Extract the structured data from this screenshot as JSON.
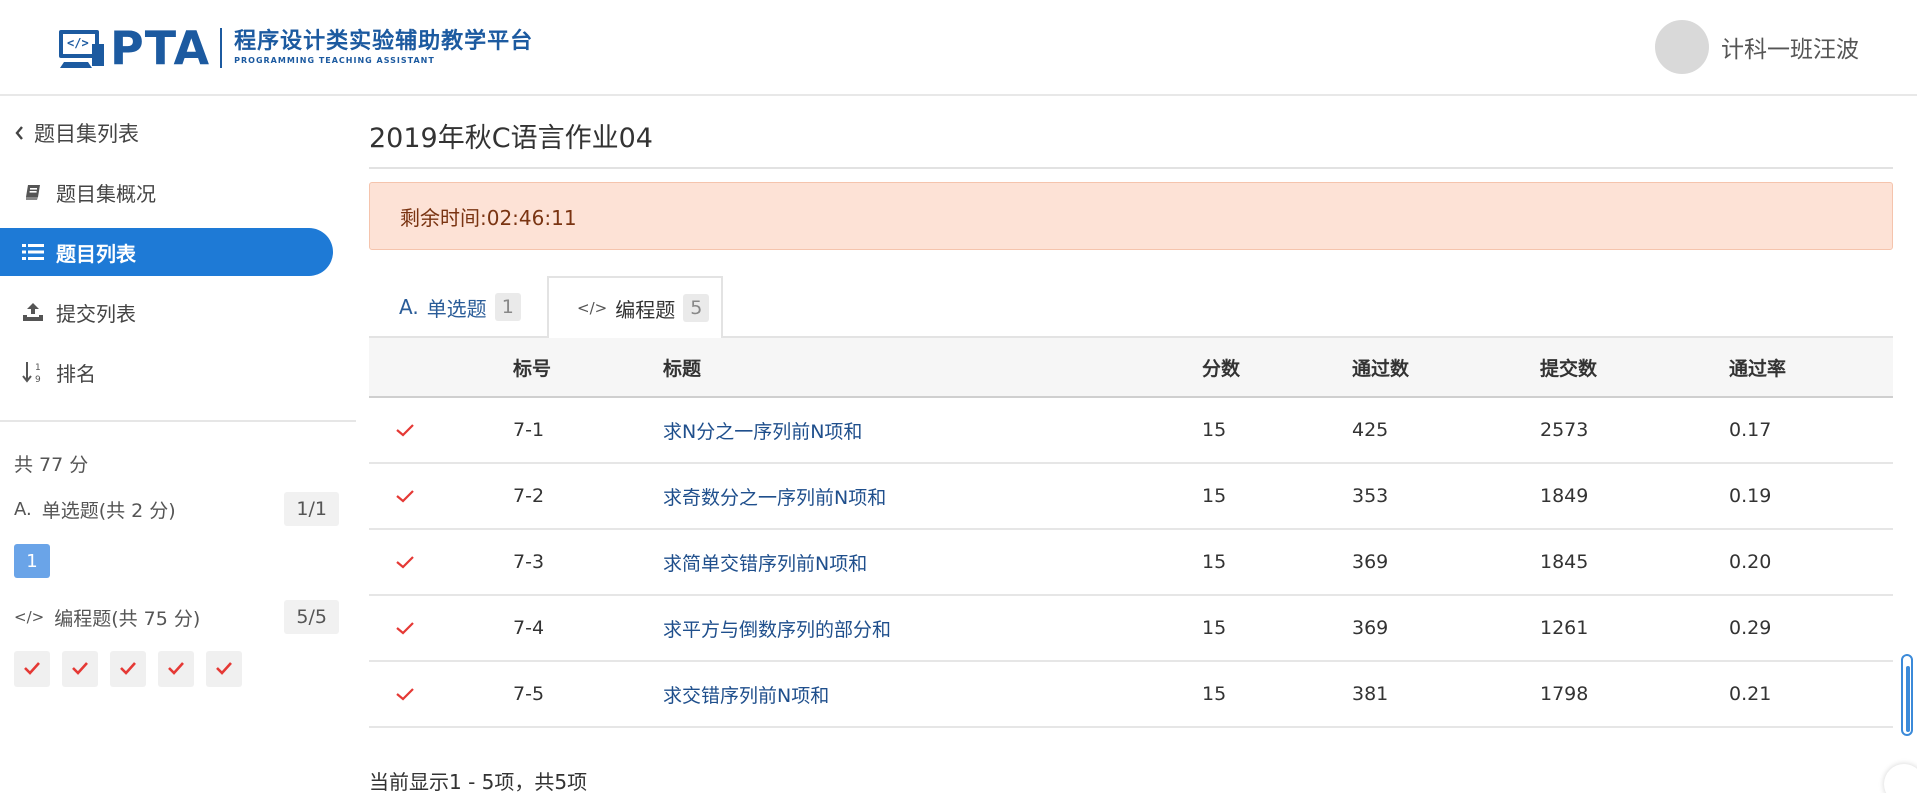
{
  "header": {
    "logo_mark": "</>",
    "logo_text": "PTA",
    "logo_cn": "程序设计类实验辅助教学平台",
    "logo_en": "PROGRAMMING TEACHING ASSISTANT",
    "user_name": "计科一班汪波"
  },
  "sidebar": {
    "back_label": "题目集列表",
    "items": [
      {
        "label": "题目集概况",
        "icon": "book-icon",
        "active": false
      },
      {
        "label": "题目列表",
        "icon": "list-icon",
        "active": true
      },
      {
        "label": "提交列表",
        "icon": "upload-icon",
        "active": false
      },
      {
        "label": "排名",
        "icon": "sort-numeric-icon",
        "active": false
      }
    ],
    "total": "共 77 分",
    "categories": [
      {
        "icon_text": "A.",
        "label": "单选题(共 2 分)",
        "count": "1/1"
      },
      {
        "icon_text": "</>",
        "label": "编程题(共 75 分)",
        "count": "5/5"
      }
    ],
    "single_choice_boxes": [
      "1"
    ]
  },
  "main": {
    "title": "2019年秋C语言作业04",
    "timer": "剩余时间:02:46:11",
    "tabs": [
      {
        "icon_text": "A.",
        "label": "单选题",
        "badge": "1",
        "active": false
      },
      {
        "icon_text": "</>",
        "label": "编程题",
        "badge": "5",
        "active": true
      }
    ],
    "table": {
      "headers": [
        "标号",
        "标题",
        "分数",
        "通过数",
        "提交数",
        "通过率"
      ],
      "rows": [
        {
          "num": "7-1",
          "title": "求N分之一序列前N项和",
          "score": "15",
          "pass": "425",
          "submit": "2573",
          "rate": "0.17"
        },
        {
          "num": "7-2",
          "title": "求奇数分之一序列前N项和",
          "score": "15",
          "pass": "353",
          "submit": "1849",
          "rate": "0.19"
        },
        {
          "num": "7-3",
          "title": "求简单交错序列前N项和",
          "score": "15",
          "pass": "369",
          "submit": "1845",
          "rate": "0.20"
        },
        {
          "num": "7-4",
          "title": "求平方与倒数序列的部分和",
          "score": "15",
          "pass": "369",
          "submit": "1261",
          "rate": "0.29"
        },
        {
          "num": "7-5",
          "title": "求交错序列前N项和",
          "score": "15",
          "pass": "381",
          "submit": "1798",
          "rate": "0.21"
        }
      ]
    },
    "footer": "当前显示1 - 5项，共5项"
  },
  "colors": {
    "brand": "#1c5aa0",
    "active_nav": "#1e7ad6",
    "check": "#e53935",
    "link": "#1f4f8c",
    "timer_bg": "#fde2d6"
  }
}
